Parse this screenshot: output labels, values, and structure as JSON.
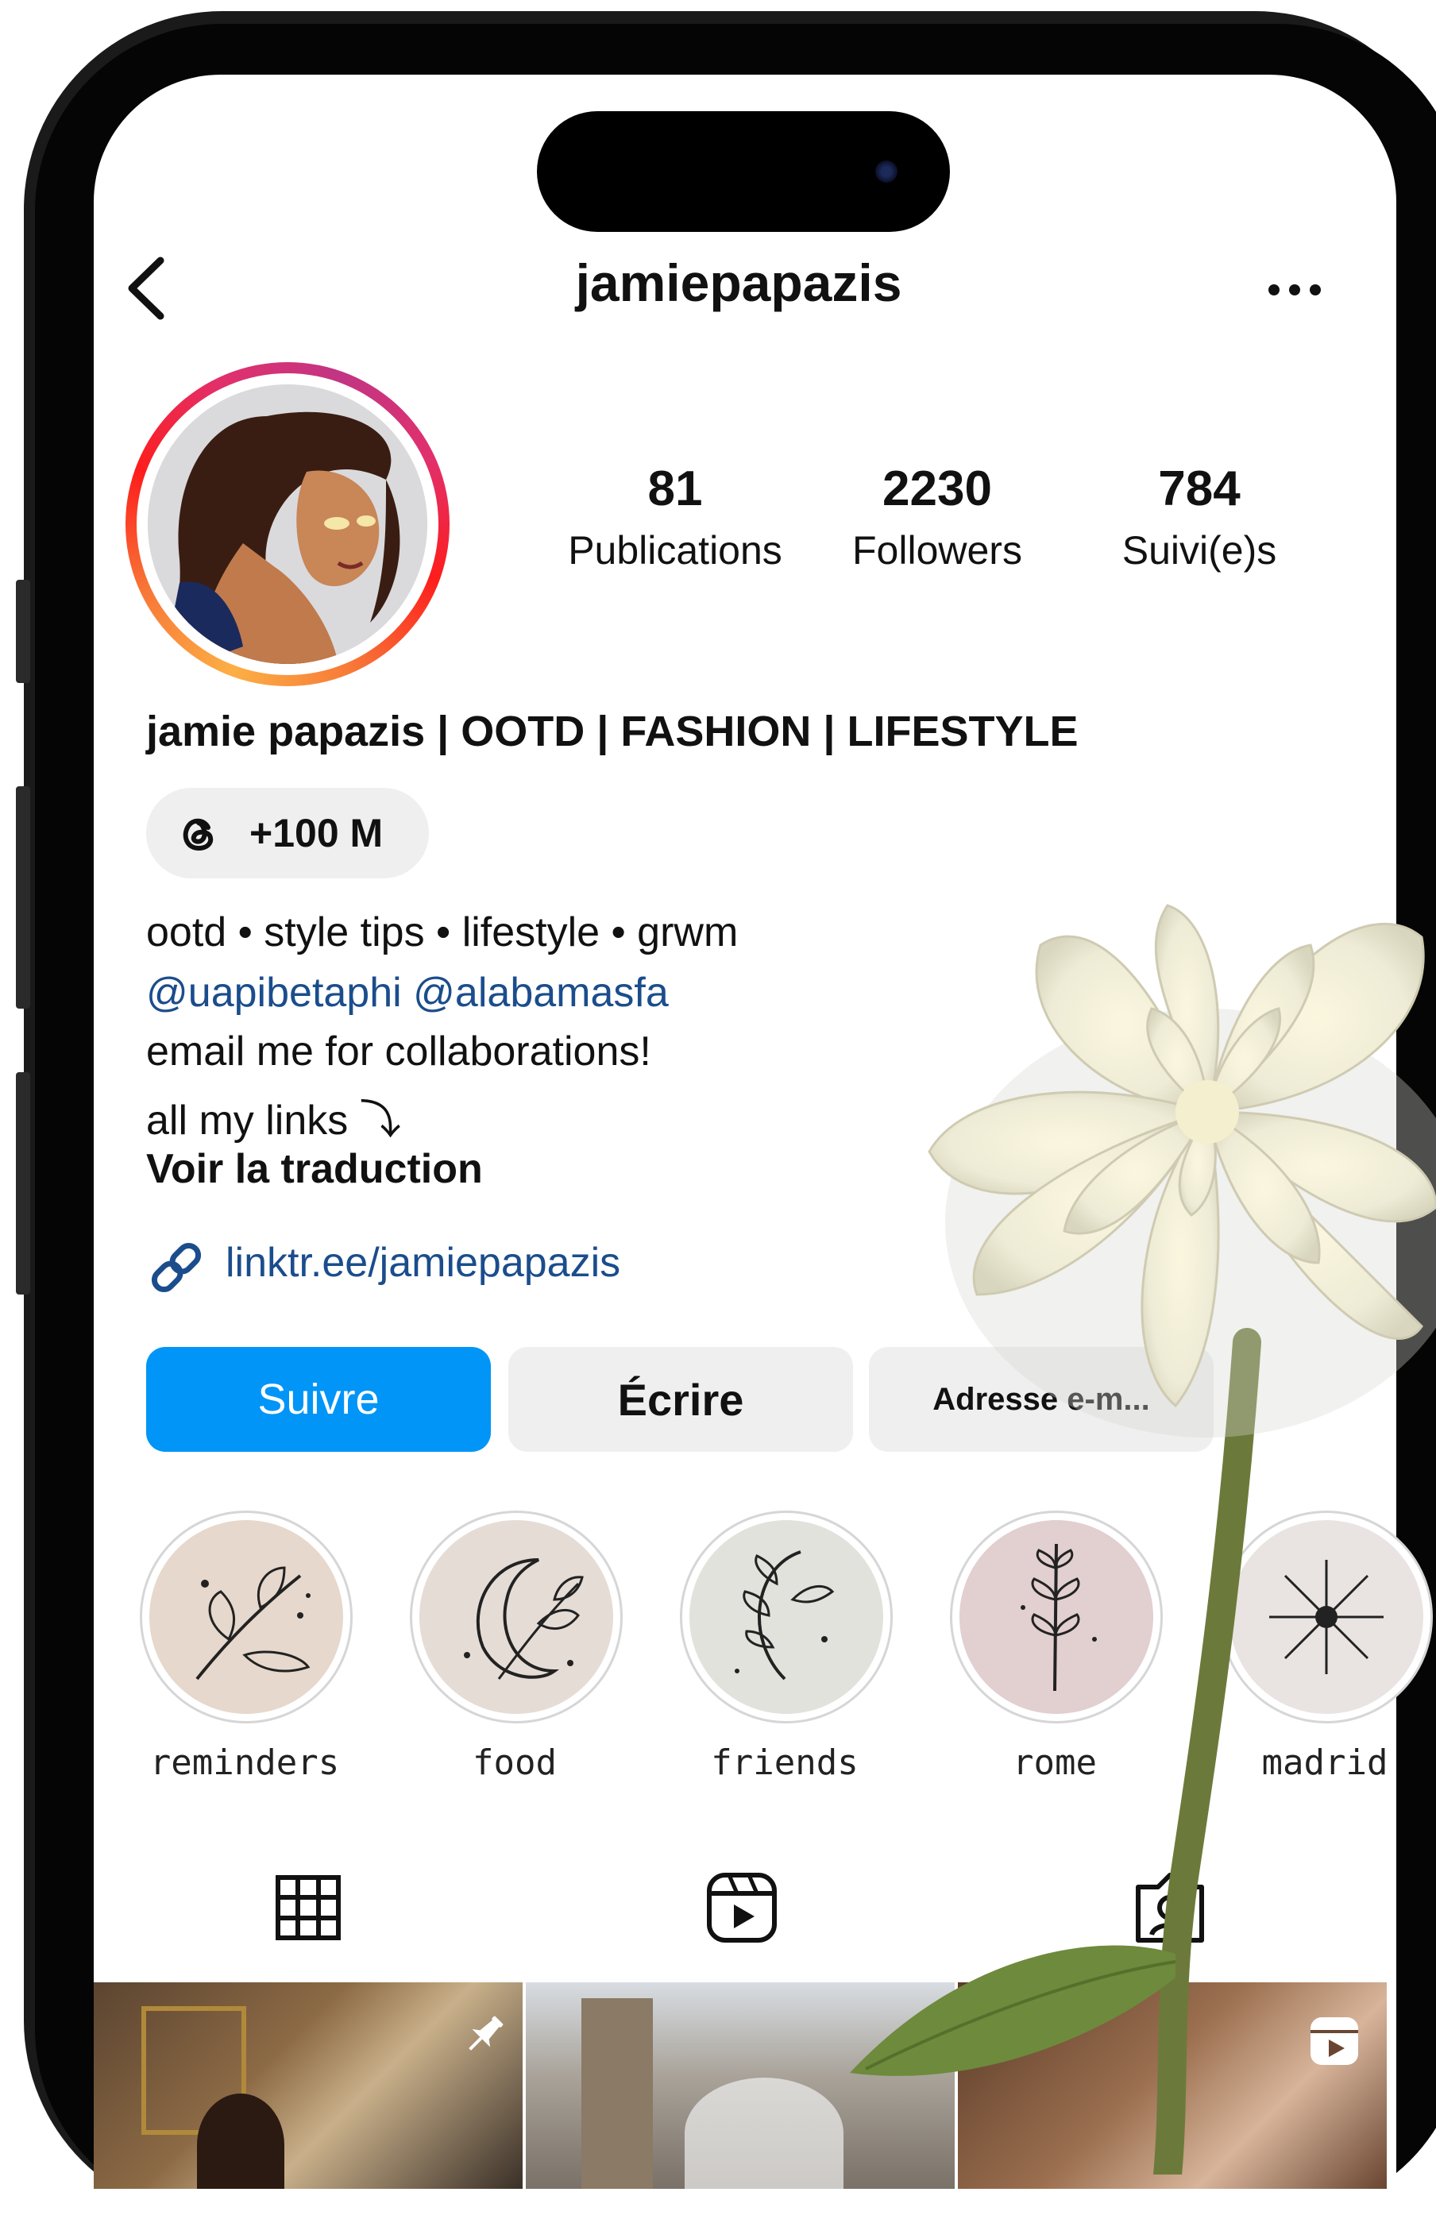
{
  "header": {
    "username": "jamiepapazis"
  },
  "stats": [
    {
      "value": "81",
      "label": "Publications"
    },
    {
      "value": "2230",
      "label": "Followers"
    },
    {
      "value": "784",
      "label": "Suivi(e)s"
    }
  ],
  "profile": {
    "display_name": "jamie papazis | OOTD | FASHION | LIFESTYLE",
    "threads_badge": "+100 M",
    "bio_line1": "ootd • style tips • lifestyle • grwm",
    "bio_mentions": "@uapibetaphi @alabamasfa",
    "bio_line3": "email me for collaborations!",
    "bio_line4": "all my links ⤵",
    "translate": "Voir la traduction",
    "link": "linktr.ee/jamiepapazis"
  },
  "actions": {
    "follow": "Suivre",
    "message": "Écrire",
    "email": "Adresse e-m..."
  },
  "highlights": [
    {
      "label": "reminders"
    },
    {
      "label": "food"
    },
    {
      "label": "friends"
    },
    {
      "label": "rome"
    },
    {
      "label": "madrid"
    }
  ],
  "tabs": [
    {
      "icon": "grid-icon"
    },
    {
      "icon": "reels-icon"
    },
    {
      "icon": "tagged-icon"
    }
  ],
  "colors": {
    "follow_blue": "#0095f6",
    "link_blue": "#1b4d8c",
    "button_gray": "#efefef"
  }
}
